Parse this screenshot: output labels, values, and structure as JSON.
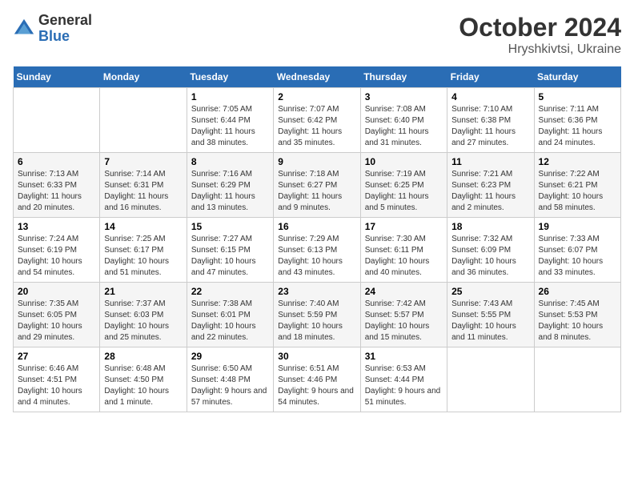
{
  "header": {
    "logo_line1": "General",
    "logo_line2": "Blue",
    "month": "October 2024",
    "location": "Hryshkivtsi, Ukraine"
  },
  "weekdays": [
    "Sunday",
    "Monday",
    "Tuesday",
    "Wednesday",
    "Thursday",
    "Friday",
    "Saturday"
  ],
  "weeks": [
    [
      {
        "day": "",
        "info": ""
      },
      {
        "day": "",
        "info": ""
      },
      {
        "day": "1",
        "info": "Sunrise: 7:05 AM\nSunset: 6:44 PM\nDaylight: 11 hours and 38 minutes."
      },
      {
        "day": "2",
        "info": "Sunrise: 7:07 AM\nSunset: 6:42 PM\nDaylight: 11 hours and 35 minutes."
      },
      {
        "day": "3",
        "info": "Sunrise: 7:08 AM\nSunset: 6:40 PM\nDaylight: 11 hours and 31 minutes."
      },
      {
        "day": "4",
        "info": "Sunrise: 7:10 AM\nSunset: 6:38 PM\nDaylight: 11 hours and 27 minutes."
      },
      {
        "day": "5",
        "info": "Sunrise: 7:11 AM\nSunset: 6:36 PM\nDaylight: 11 hours and 24 minutes."
      }
    ],
    [
      {
        "day": "6",
        "info": "Sunrise: 7:13 AM\nSunset: 6:33 PM\nDaylight: 11 hours and 20 minutes."
      },
      {
        "day": "7",
        "info": "Sunrise: 7:14 AM\nSunset: 6:31 PM\nDaylight: 11 hours and 16 minutes."
      },
      {
        "day": "8",
        "info": "Sunrise: 7:16 AM\nSunset: 6:29 PM\nDaylight: 11 hours and 13 minutes."
      },
      {
        "day": "9",
        "info": "Sunrise: 7:18 AM\nSunset: 6:27 PM\nDaylight: 11 hours and 9 minutes."
      },
      {
        "day": "10",
        "info": "Sunrise: 7:19 AM\nSunset: 6:25 PM\nDaylight: 11 hours and 5 minutes."
      },
      {
        "day": "11",
        "info": "Sunrise: 7:21 AM\nSunset: 6:23 PM\nDaylight: 11 hours and 2 minutes."
      },
      {
        "day": "12",
        "info": "Sunrise: 7:22 AM\nSunset: 6:21 PM\nDaylight: 10 hours and 58 minutes."
      }
    ],
    [
      {
        "day": "13",
        "info": "Sunrise: 7:24 AM\nSunset: 6:19 PM\nDaylight: 10 hours and 54 minutes."
      },
      {
        "day": "14",
        "info": "Sunrise: 7:25 AM\nSunset: 6:17 PM\nDaylight: 10 hours and 51 minutes."
      },
      {
        "day": "15",
        "info": "Sunrise: 7:27 AM\nSunset: 6:15 PM\nDaylight: 10 hours and 47 minutes."
      },
      {
        "day": "16",
        "info": "Sunrise: 7:29 AM\nSunset: 6:13 PM\nDaylight: 10 hours and 43 minutes."
      },
      {
        "day": "17",
        "info": "Sunrise: 7:30 AM\nSunset: 6:11 PM\nDaylight: 10 hours and 40 minutes."
      },
      {
        "day": "18",
        "info": "Sunrise: 7:32 AM\nSunset: 6:09 PM\nDaylight: 10 hours and 36 minutes."
      },
      {
        "day": "19",
        "info": "Sunrise: 7:33 AM\nSunset: 6:07 PM\nDaylight: 10 hours and 33 minutes."
      }
    ],
    [
      {
        "day": "20",
        "info": "Sunrise: 7:35 AM\nSunset: 6:05 PM\nDaylight: 10 hours and 29 minutes."
      },
      {
        "day": "21",
        "info": "Sunrise: 7:37 AM\nSunset: 6:03 PM\nDaylight: 10 hours and 25 minutes."
      },
      {
        "day": "22",
        "info": "Sunrise: 7:38 AM\nSunset: 6:01 PM\nDaylight: 10 hours and 22 minutes."
      },
      {
        "day": "23",
        "info": "Sunrise: 7:40 AM\nSunset: 5:59 PM\nDaylight: 10 hours and 18 minutes."
      },
      {
        "day": "24",
        "info": "Sunrise: 7:42 AM\nSunset: 5:57 PM\nDaylight: 10 hours and 15 minutes."
      },
      {
        "day": "25",
        "info": "Sunrise: 7:43 AM\nSunset: 5:55 PM\nDaylight: 10 hours and 11 minutes."
      },
      {
        "day": "26",
        "info": "Sunrise: 7:45 AM\nSunset: 5:53 PM\nDaylight: 10 hours and 8 minutes."
      }
    ],
    [
      {
        "day": "27",
        "info": "Sunrise: 6:46 AM\nSunset: 4:51 PM\nDaylight: 10 hours and 4 minutes."
      },
      {
        "day": "28",
        "info": "Sunrise: 6:48 AM\nSunset: 4:50 PM\nDaylight: 10 hours and 1 minute."
      },
      {
        "day": "29",
        "info": "Sunrise: 6:50 AM\nSunset: 4:48 PM\nDaylight: 9 hours and 57 minutes."
      },
      {
        "day": "30",
        "info": "Sunrise: 6:51 AM\nSunset: 4:46 PM\nDaylight: 9 hours and 54 minutes."
      },
      {
        "day": "31",
        "info": "Sunrise: 6:53 AM\nSunset: 4:44 PM\nDaylight: 9 hours and 51 minutes."
      },
      {
        "day": "",
        "info": ""
      },
      {
        "day": "",
        "info": ""
      }
    ]
  ]
}
